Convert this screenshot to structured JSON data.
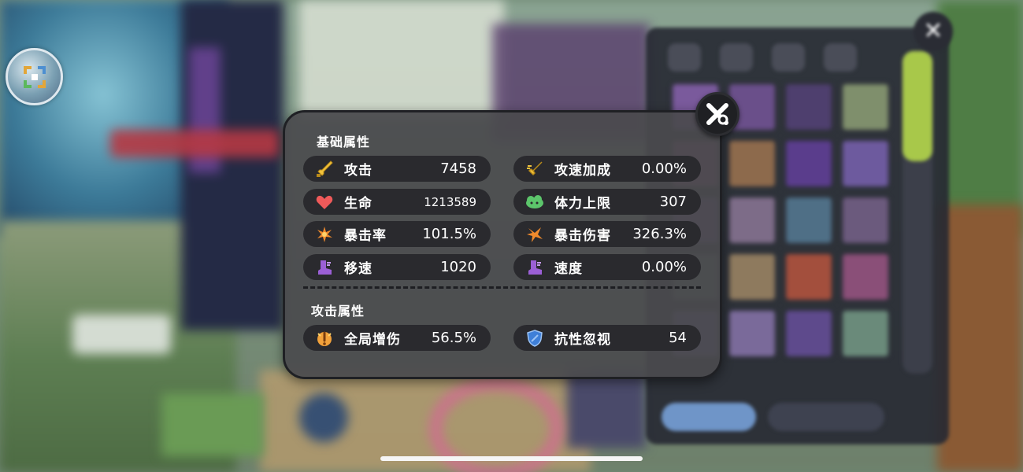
{
  "panel": {
    "basic_section_title": "基础属性",
    "attack_section_title": "攻击属性",
    "close_label": "✕"
  },
  "basic_stats": [
    {
      "label": "攻击",
      "value": "7458",
      "icon": "sword-icon",
      "color": "#f3c33b"
    },
    {
      "label": "攻速加成",
      "value": "0.00%",
      "icon": "attack-speed-sword-icon",
      "color": "#f3c33b"
    },
    {
      "label": "生命",
      "value": "1213589",
      "icon": "heart-icon",
      "color": "#ef5a5a"
    },
    {
      "label": "体力上限",
      "value": "307",
      "icon": "stamina-cloud-icon",
      "color": "#5cc56b"
    },
    {
      "label": "暴击率",
      "value": "101.5%",
      "icon": "crit-burst-icon",
      "color": "#f08a2c"
    },
    {
      "label": "暴击伤害",
      "value": "326.3%",
      "icon": "crit-damage-icon",
      "color": "#f08a2c"
    },
    {
      "label": "移速",
      "value": "1020",
      "icon": "boot-icon",
      "color": "#9b5fd6"
    },
    {
      "label": "速度",
      "value": "0.00%",
      "icon": "boot-speed-icon",
      "color": "#9b5fd6"
    }
  ],
  "attack_stats": [
    {
      "label": "全局增伤",
      "value": "56.5%",
      "icon": "damage-boost-icon",
      "color": "#f3a23b"
    },
    {
      "label": "抗性忽视",
      "value": "54",
      "icon": "shield-icon",
      "color": "#3e7fd8"
    }
  ],
  "colors": {
    "panel_bg": "#4a4a4e",
    "row_bg": "#2a2a2e",
    "text": "#ffffff",
    "scroll_accent": "#a8c84a"
  }
}
